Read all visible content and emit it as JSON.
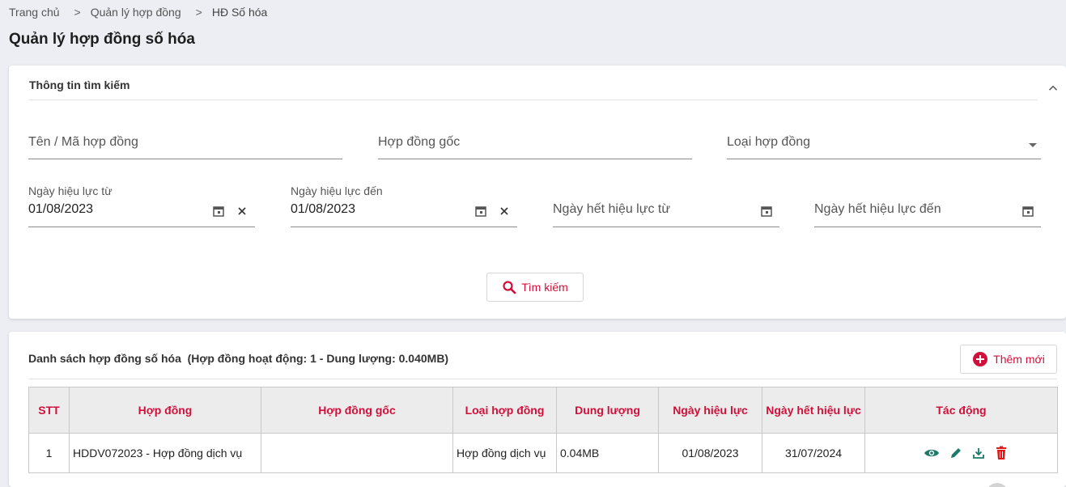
{
  "breadcrumb": {
    "home": "Trang chủ",
    "sep": ">",
    "level1": "Quản lý hợp đồng",
    "current": "HĐ Số hóa"
  },
  "page_title": "Quản lý hợp đồng số hóa",
  "search": {
    "title": "Thông tin tìm kiếm",
    "name_code_placeholder": "Tên / Mã hợp đồng",
    "original_placeholder": "Hợp đồng gốc",
    "type_placeholder": "Loại hợp đồng",
    "effective_from": {
      "label": "Ngày hiệu lực từ",
      "value": "01/08/2023"
    },
    "effective_to": {
      "label": "Ngày hiệu lực đến",
      "value": "01/08/2023"
    },
    "expiry_from_placeholder": "Ngày hết hiệu lực từ",
    "expiry_to_placeholder": "Ngày hết hiệu lực đến",
    "search_button": "Tìm kiếm"
  },
  "list": {
    "title": "Danh sách hợp đồng số hóa",
    "summary": "(Hợp đồng hoạt động: 1 - Dung lượng: 0.040MB)",
    "add_button": "Thêm mới",
    "columns": [
      "STT",
      "Hợp đồng",
      "Hợp đồng gốc",
      "Loại hợp đồng",
      "Dung lượng",
      "Ngày hiệu lực",
      "Ngày hết hiệu lực",
      "Tác động"
    ],
    "rows": [
      {
        "stt": "1",
        "contract": "HDDV072023 - Hợp đồng dịch vụ",
        "original": "",
        "type": "Hợp đồng dịch vụ",
        "size": "0.04MB",
        "effective_date": "01/08/2023",
        "expiry_date": "31/07/2024"
      }
    ]
  },
  "colors": {
    "accent": "#d0103a",
    "action_teal": "#1b7a69",
    "delete_red": "#e01919"
  },
  "icons": [
    "chevron-up-icon",
    "calendar-icon",
    "clear-icon",
    "search-icon",
    "add-circle-icon",
    "eye-icon",
    "edit-icon",
    "download-icon",
    "trash-icon"
  ]
}
